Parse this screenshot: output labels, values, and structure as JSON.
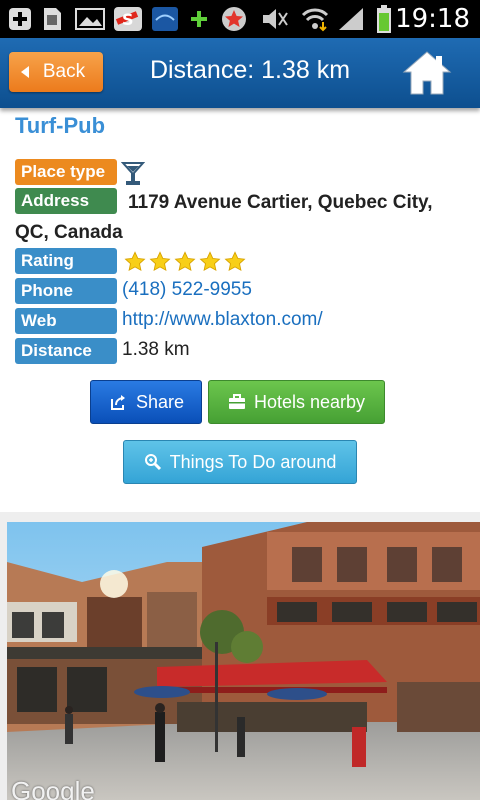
{
  "statusbar": {
    "time": "19:18"
  },
  "header": {
    "back_label": "Back",
    "title": "Distance: 1.38 km"
  },
  "place": {
    "name": "Turf-Pub",
    "place_type_label": "Place type",
    "address_label": "Address",
    "address": "1179 Avenue Cartier, Quebec City, QC, Canada",
    "rating_label": "Rating",
    "rating": 5,
    "phone_label": "Phone",
    "phone": "(418) 522-9955",
    "web_label": "Web",
    "web": "http://www.blaxton.com/",
    "distance_label": "Distance",
    "distance": "1.38 km"
  },
  "actions": {
    "share": "Share",
    "hotels": "Hotels nearby",
    "things": "Things To Do around"
  },
  "photo": {
    "watermark": "Google"
  },
  "colors": {
    "accent_orange": "#ec7b1c",
    "header_blue": "#1a5fa3",
    "label_blue": "#3a8ec8",
    "label_green": "#3f8a4f",
    "name_blue": "#3a8fd6"
  }
}
